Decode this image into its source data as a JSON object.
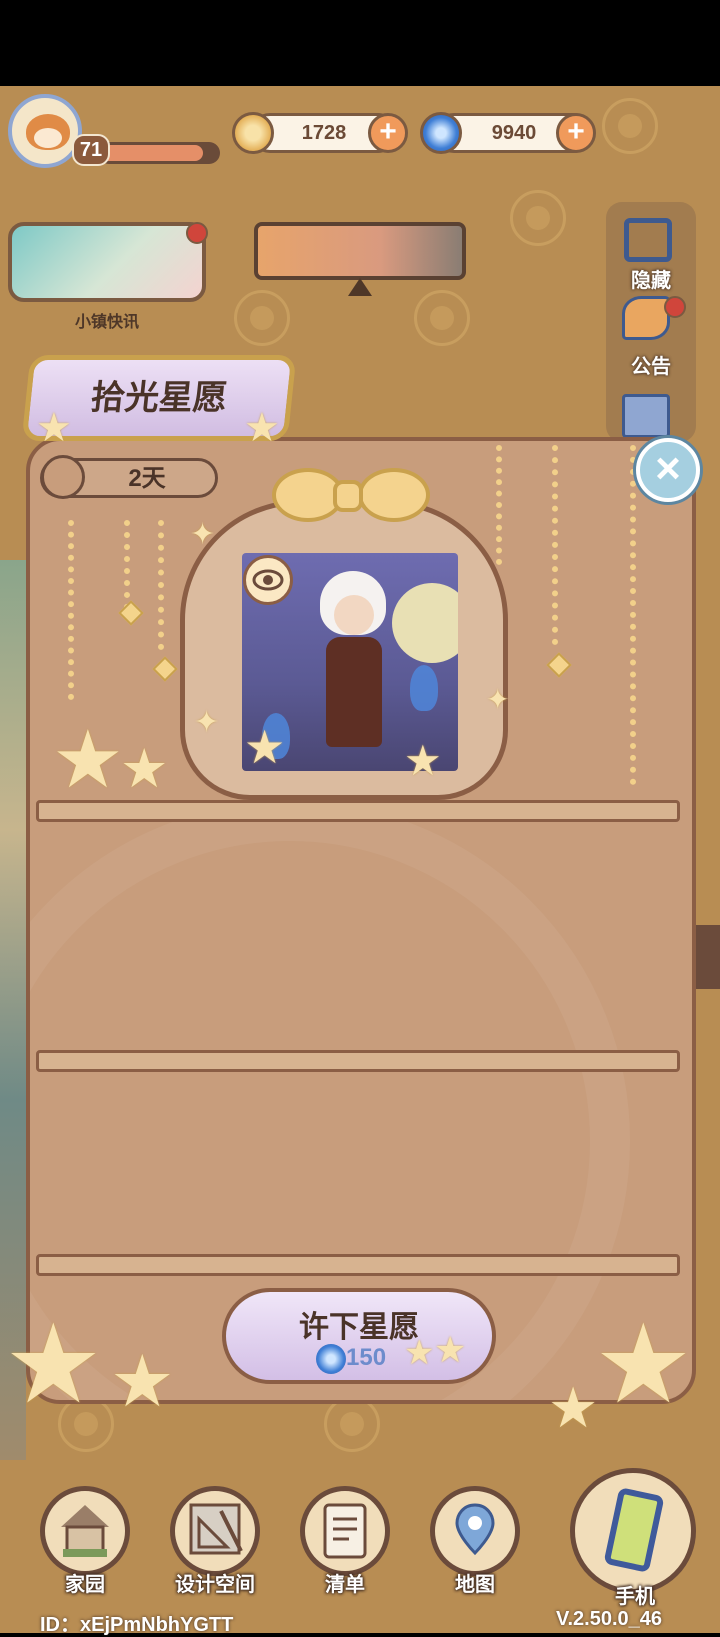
{
  "player": {
    "level": "71",
    "xp_fraction": 0.86
  },
  "currency": {
    "coins": "1728",
    "gems": "9940",
    "plus_glyph": "+"
  },
  "news": {
    "label": "小镇快讯"
  },
  "side_panel": {
    "hide_label": "隐藏",
    "announcement_label": "公告"
  },
  "wish_event": {
    "title": "拾光星愿",
    "timer": "2天",
    "close_glyph": "×",
    "wish_button_label": "许下星愿",
    "wish_cost": "150"
  },
  "nav": {
    "home": "家园",
    "design": "设计空间",
    "list": "清单",
    "map": "地图",
    "phone": "手机"
  },
  "footer": {
    "player_id": "ID：xEjPmNbhYGTT",
    "version": "V.2.50.0_46"
  },
  "colors": {
    "background": "#b88d53",
    "card": "#c89d7c",
    "accent_gold": "#f4d38e",
    "wish_purple": "#d3bfe6"
  }
}
